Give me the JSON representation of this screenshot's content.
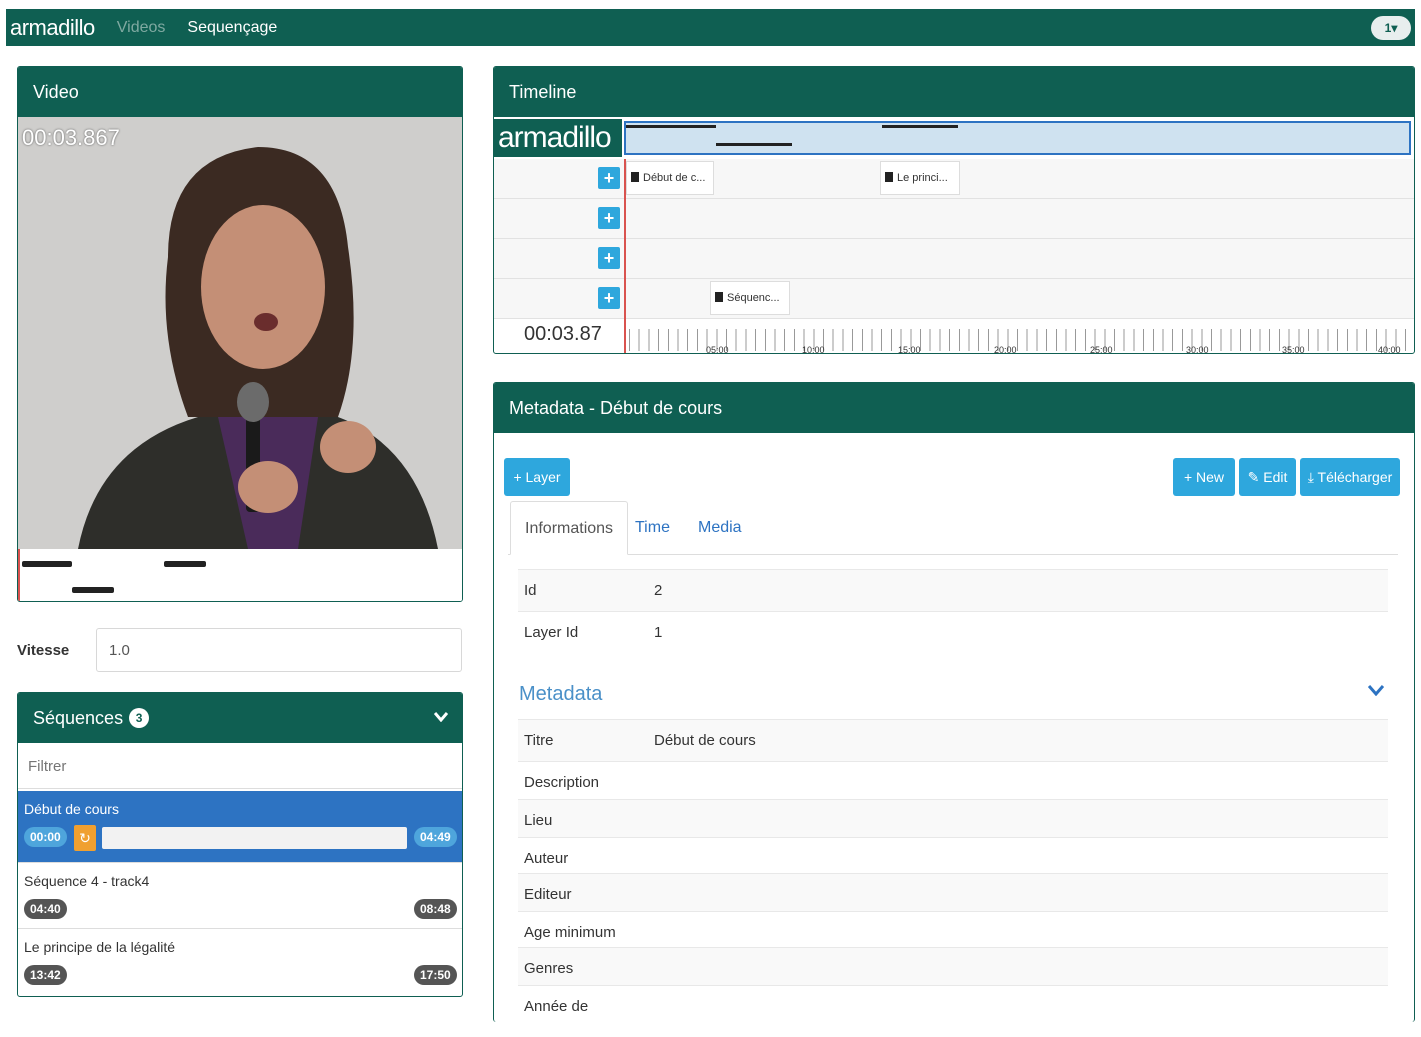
{
  "navbar": {
    "brand": "armadillo",
    "links": [
      "Videos",
      "Sequençage"
    ],
    "user_menu": "1▾"
  },
  "video": {
    "title": "Video",
    "timecode": "00:03.867"
  },
  "vitesse": {
    "label": "Vitesse",
    "value": "1.0"
  },
  "sequences": {
    "title": "Séquences",
    "count": "3",
    "filter_placeholder": "Filtrer",
    "items": [
      {
        "title": "Début de cours",
        "start": "00:00",
        "end": "04:49"
      },
      {
        "title": "Séquence 4 - track4",
        "start": "04:40",
        "end": "08:48"
      },
      {
        "title": "Le principe de la légalité",
        "start": "13:42",
        "end": "17:50"
      }
    ]
  },
  "timeline": {
    "title": "Timeline",
    "logo": "armadillo",
    "segments": [
      "Début de c...",
      "Le princi...",
      "Séquenc..."
    ],
    "current_time": "00:03.87",
    "ticks": [
      "05:00",
      "10:00",
      "15:00",
      "20:00",
      "25:00",
      "30:00",
      "35:00",
      "40:00"
    ]
  },
  "metadata": {
    "title": "Metadata - Début de cours",
    "buttons": {
      "layer": "+ Layer",
      "new": "+ New",
      "edit": "✎ Edit",
      "download": "⤓ Télécharger"
    },
    "tabs": [
      "Informations",
      "Time",
      "Media"
    ],
    "info": [
      {
        "k": "Id",
        "v": "2"
      },
      {
        "k": "Layer Id",
        "v": "1"
      }
    ],
    "section": "Metadata",
    "fields": [
      {
        "k": "Titre",
        "v": "Début de cours"
      },
      {
        "k": "Description",
        "v": ""
      },
      {
        "k": "Lieu",
        "v": ""
      },
      {
        "k": "Auteur",
        "v": ""
      },
      {
        "k": "Editeur",
        "v": ""
      },
      {
        "k": "Age minimum",
        "v": ""
      },
      {
        "k": "Genres",
        "v": ""
      },
      {
        "k": "Année de",
        "v": ""
      }
    ]
  }
}
